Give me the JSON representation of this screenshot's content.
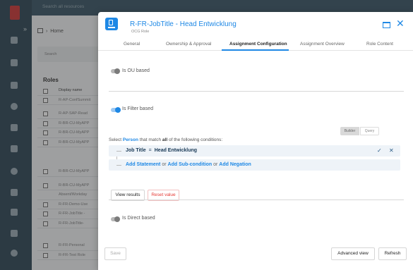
{
  "background": {
    "search_placeholder": "Search all resources",
    "breadcrumb_home": "Home",
    "filter_label": "Search",
    "roles_heading": "Roles",
    "table_header": "Display name",
    "rows": [
      "R-AP-ConfSummit",
      "R-AP-SAP-Read",
      "R-BR-CU-MyAPP",
      "R-BR-CU-MyAPP",
      "R-BR-CU-MyAPP",
      "R-BR-CU-MyAPP",
      "R-BR-CU-MyAPP",
      "Absent/Workday",
      "R-FR-Demo-Use",
      "R-FR-JobTitle -",
      "R-FR-JobTitle-",
      "R-FR-Personal",
      "R-FR-Test Role"
    ]
  },
  "modal": {
    "title": "R-FR-JobTitle - Head Entwicklung",
    "subtitle": "OCG Role",
    "tabs": [
      {
        "label": "General"
      },
      {
        "label": "Ownership & Approval"
      },
      {
        "label": "Assignment Configuration"
      },
      {
        "label": "Assignment Overview"
      },
      {
        "label": "Role Content"
      }
    ],
    "active_tab": "Assignment Configuration",
    "ou_based": {
      "label": "Is OU based",
      "enabled": false
    },
    "filter_based": {
      "label": "Is Filter based",
      "enabled": true
    },
    "direct_based": {
      "label": "Is Direct based",
      "enabled": false
    },
    "mode_builder": "Builder",
    "mode_query": "Query",
    "condition": {
      "prefix": "Select",
      "entity": "Person",
      "middle": "that match",
      "quantifier": "all",
      "suffix": "of the following conditions:"
    },
    "statement": {
      "field": "Job Title",
      "operator": "=",
      "value": "Head Entwicklung"
    },
    "add": {
      "statement": "Add Statement",
      "or1": "or",
      "subcondition": "Add Sub-condition",
      "or2": "or",
      "negation": "Add Negation"
    },
    "view_results": "View results",
    "reset_value": "Reset value",
    "save": "Save",
    "advanced_view": "Advanced view",
    "refresh": "Refresh"
  },
  "colors": {
    "accent": "#1e88e5",
    "danger": "#e53935",
    "sidebar": "#1f3a4a"
  }
}
